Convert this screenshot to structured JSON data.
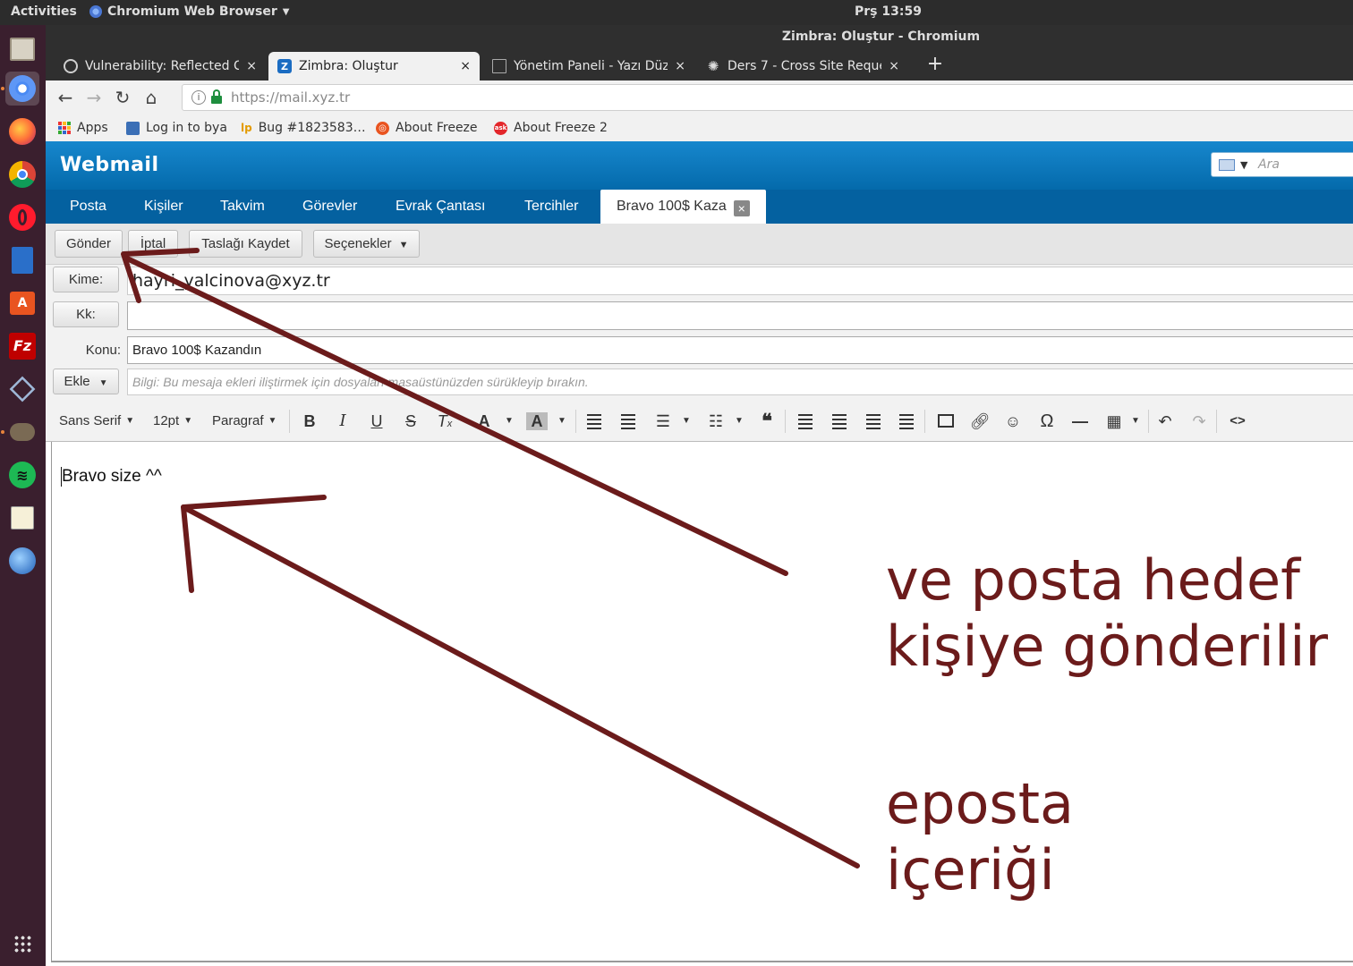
{
  "topbar": {
    "activities": "Activities",
    "app_name": "Chromium Web Browser",
    "clock": "Prş 13:59"
  },
  "window": {
    "title": "Zimbra: Oluştur - Chromium"
  },
  "tabs": [
    {
      "title": "Vulnerability: Reflected C",
      "close": "×"
    },
    {
      "title": "Zimbra: Oluştur",
      "close": "×"
    },
    {
      "title": "Yönetim Paneli - Yazı Düze",
      "close": "×"
    },
    {
      "title": "Ders 7 - Cross Site Reques",
      "close": "×"
    }
  ],
  "new_tab": "+",
  "address_bar": {
    "url": "https://mail.xyz.tr"
  },
  "bookmarks": [
    {
      "label": "Apps"
    },
    {
      "label": "Log in to bya"
    },
    {
      "label": "Bug #1823583…"
    },
    {
      "label": "About Freeze"
    },
    {
      "label": "About Freeze 2"
    }
  ],
  "webmail": {
    "logo": "Webmail",
    "search_placeholder": "Ara",
    "nav": [
      "Posta",
      "Kişiler",
      "Takvim",
      "Görevler",
      "Evrak Çantası",
      "Tercihler"
    ],
    "active_tab": "Bravo 100$ Kaza",
    "actions": {
      "send": "Gönder",
      "cancel": "İptal",
      "save_draft": "Taslağı Kaydet",
      "options": "Seçenekler"
    },
    "compose": {
      "to_label": "Kime:",
      "to_value": "hayri_yalcinova@xyz.tr",
      "cc_label": "Kk:",
      "cc_value": "",
      "subject_label": "Konu:",
      "subject_value": "Bravo 100$ Kazandın",
      "attach_label": "Ekle",
      "attach_hint": "Bilgi: Bu mesaja ekleri iliştirmek için dosyaları masaüstünüzden sürükleyip bırakın."
    },
    "editor_toolbar": {
      "font": "Sans Serif",
      "size": "12pt",
      "format": "Paragraf"
    },
    "body_text": "Bravo size ^^"
  },
  "annotations": {
    "note1_line1": "ve posta hedef",
    "note1_line2": "kişiye gönderilir",
    "note2_line1": "eposta",
    "note2_line2": "içeriği",
    "color": "#6b1b1b"
  },
  "colors": {
    "zimbra_header": "#0a7ac0",
    "zimbra_nav": "#0461a0",
    "dock": "#3a1f2e"
  }
}
